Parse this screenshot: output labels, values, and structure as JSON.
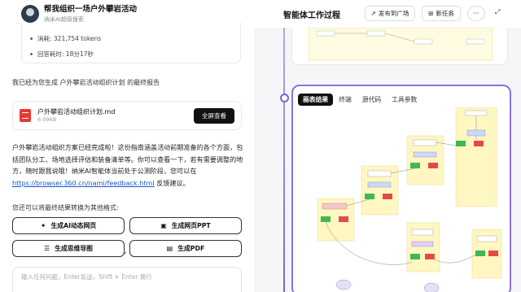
{
  "header": {
    "title": "帮我组织一场户外攀岩活动",
    "subtitle": "纳米AI超级搜索"
  },
  "stats": {
    "tokens": "消耗: 321,754 tokens",
    "time": "回答耗时: 18分17秒"
  },
  "generated_text": "我已经为您生成 户外攀岩活动组织计划 的最终报告",
  "file": {
    "name": "户外攀岩活动组织计划.md",
    "size": "6.09KB",
    "view_label": "全屏查看"
  },
  "message": {
    "text": "户外攀岩活动组织方案已经完成啦！这份指南涵盖活动前期准备的各个方面，包括团队分工、场地选择评估和装备清单等。你可以查看一下，若有需要调整的地方，随时跟我说哦！纳米AI智能体当前处于公测阶段，您可以在 ",
    "link": "https://browser.360.cn/nami/feedback.html",
    "suffix": " 反馈建议。"
  },
  "convert_label": "您还可以将最终结果转换为其他格式:",
  "convert_buttons": [
    {
      "label": "生成AI动态网页",
      "icon": "magic-wand-icon"
    },
    {
      "label": "生成网页PPT",
      "icon": "presentation-icon"
    },
    {
      "label": "生成思维导图",
      "icon": "mindmap-icon"
    },
    {
      "label": "生成PDF",
      "icon": "pdf-icon"
    }
  ],
  "input": {
    "placeholder": "输入任何问题，Enter发送，Shift + Enter 换行"
  },
  "right": {
    "title": "智能体工作过程",
    "publish_label": "发布到广场",
    "new_task_label": "新任务",
    "more_label": "···",
    "tabs": [
      "画表结果",
      "终端",
      "源代码",
      "工具参数"
    ]
  },
  "colors": {
    "accent": "#7b62d8",
    "link": "#1a56c9",
    "file_icon": "#e53935",
    "dark_button": "#111111",
    "node_yellow": "#fff7c2",
    "node_green": "#3fb950",
    "node_red": "#e5484d"
  }
}
